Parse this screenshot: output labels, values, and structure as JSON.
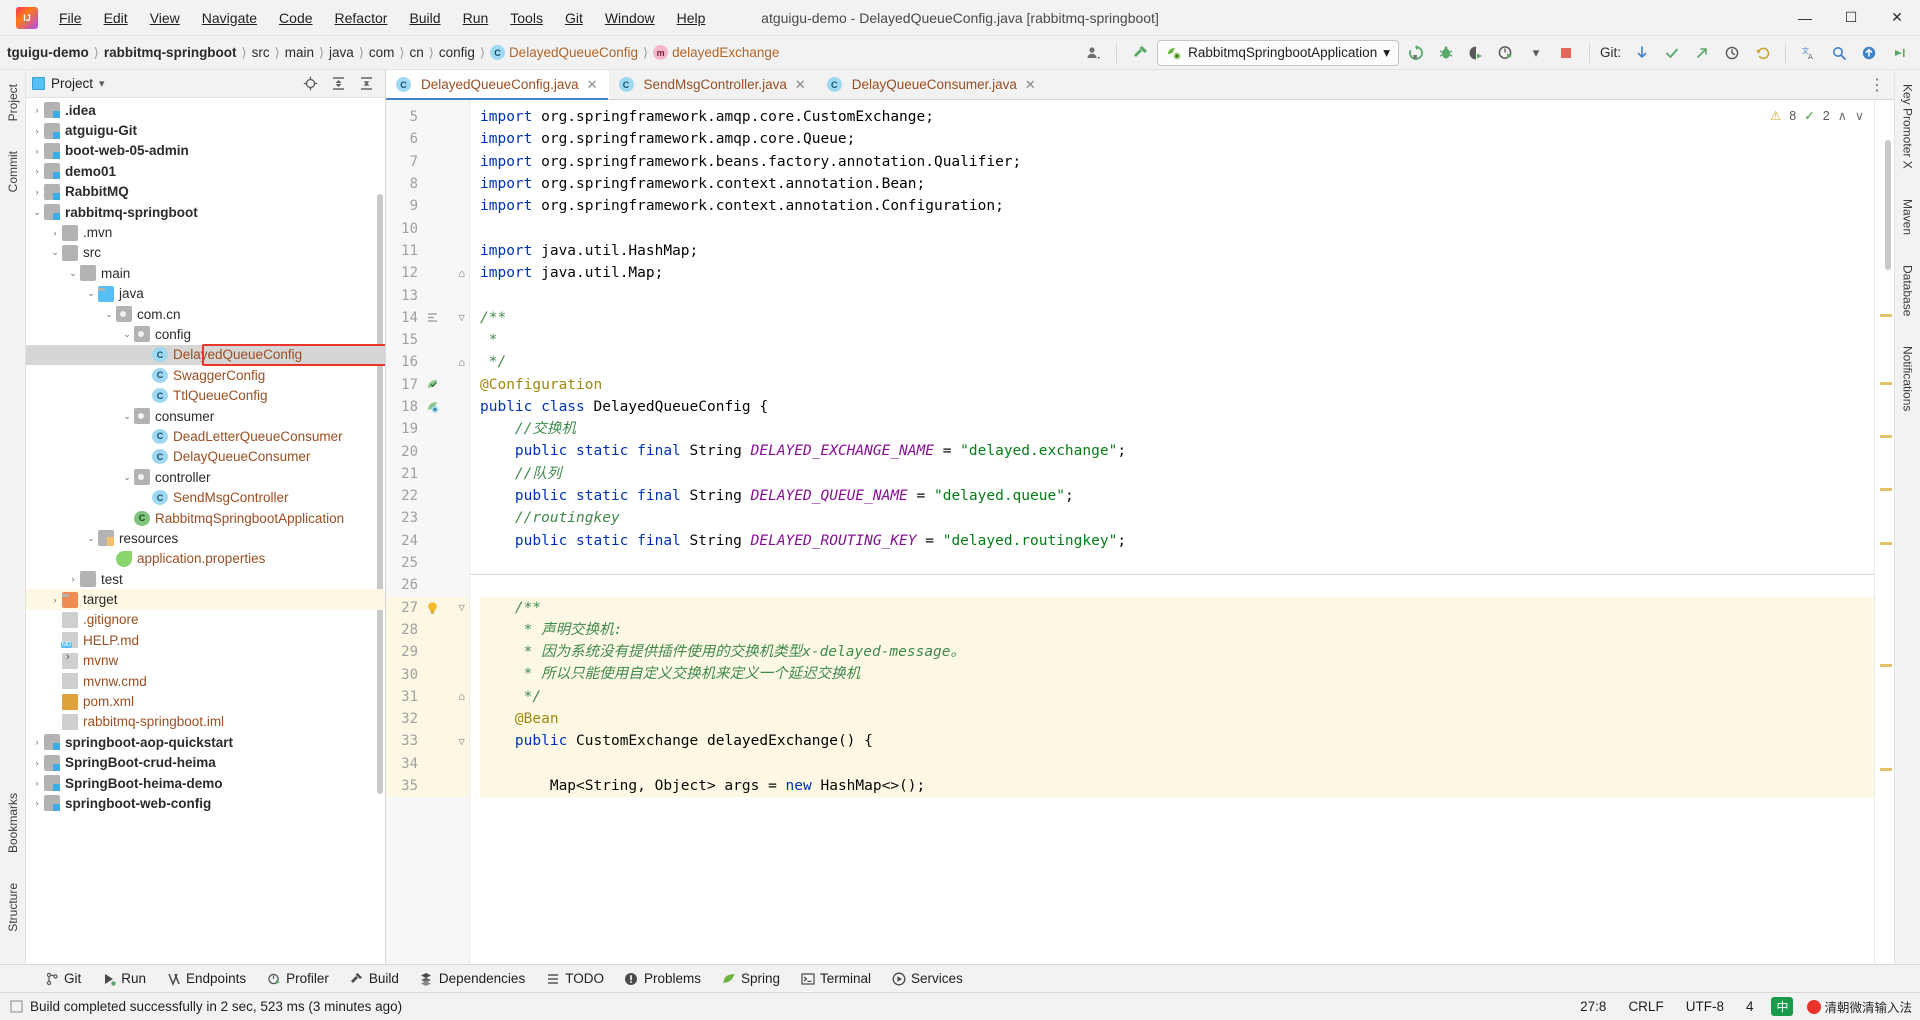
{
  "window": {
    "title": "atguigu-demo - DelayedQueueConfig.java [rabbitmq-springboot]",
    "minimize": "—",
    "maximize": "☐",
    "close": "✕",
    "logo_text": "IJ"
  },
  "menubar": [
    {
      "label": "File"
    },
    {
      "label": "Edit"
    },
    {
      "label": "View"
    },
    {
      "label": "Navigate"
    },
    {
      "label": "Code"
    },
    {
      "label": "Refactor"
    },
    {
      "label": "Build"
    },
    {
      "label": "Run"
    },
    {
      "label": "Tools"
    },
    {
      "label": "Git"
    },
    {
      "label": "Window"
    },
    {
      "label": "Help"
    }
  ],
  "breadcrumbs": [
    {
      "label": "tguigu-demo",
      "style": "bold"
    },
    {
      "label": "rabbitmq-springboot",
      "style": "bold"
    },
    {
      "label": "src",
      "style": "plain"
    },
    {
      "label": "main",
      "style": "plain"
    },
    {
      "label": "java",
      "style": "plain"
    },
    {
      "label": "com",
      "style": "plain"
    },
    {
      "label": "cn",
      "style": "plain"
    },
    {
      "label": "config",
      "style": "plain"
    },
    {
      "label": "DelayedQueueConfig",
      "style": "class",
      "badge": "C"
    },
    {
      "label": "delayedExchange",
      "style": "method",
      "badge": "m"
    }
  ],
  "toolbar": {
    "run_config": "RabbitmqSpringbootApplication",
    "run_config_caret": "▾",
    "git_label": "Git:",
    "icons": {
      "profile": "user-icon",
      "build_hammer": "hammer-icon",
      "rerun": "rerun-icon",
      "debug": "debug-icon",
      "coverage": "coverage-icon",
      "profiler": "profiler-icon",
      "stop": "stop-icon",
      "update_project": "update-project-icon",
      "commit": "commit-icon",
      "push": "push-icon",
      "history": "history-icon",
      "rollback": "rollback-icon",
      "translate": "translate-icon",
      "search": "search-icon",
      "updates": "updates-icon",
      "more": "more-icon"
    }
  },
  "left_strip": [
    {
      "label": "Project"
    },
    {
      "label": "Commit"
    },
    {
      "label": "Bookmarks"
    },
    {
      "label": "Structure"
    }
  ],
  "right_strip": [
    {
      "label": "Key Promoter X"
    },
    {
      "label": "Maven"
    },
    {
      "label": "Database"
    },
    {
      "label": "Notifications"
    }
  ],
  "project_panel": {
    "title": "Project",
    "caret": "▾",
    "actions": [
      "locate-icon",
      "expand-all-icon",
      "collapse-all-icon",
      "settings-icon",
      "hide-icon"
    ],
    "tree": [
      {
        "indent": 1,
        "arrow": "›",
        "icon": "folder-mod",
        "label": ".idea",
        "style": "bold",
        "state": "none"
      },
      {
        "indent": 1,
        "arrow": "›",
        "icon": "folder-mod",
        "label": "atguigu-Git",
        "style": "bold",
        "state": "none"
      },
      {
        "indent": 1,
        "arrow": "›",
        "icon": "folder-mod",
        "label": "boot-web-05-admin",
        "style": "bold",
        "state": "none"
      },
      {
        "indent": 1,
        "arrow": "›",
        "icon": "folder-mod",
        "label": "demo01",
        "style": "bold",
        "state": "none"
      },
      {
        "indent": 1,
        "arrow": "›",
        "icon": "folder-mod",
        "label": "RabbitMQ",
        "style": "bold",
        "state": "none"
      },
      {
        "indent": 1,
        "arrow": "⌄",
        "icon": "folder-mod",
        "label": "rabbitmq-springboot",
        "style": "bold",
        "state": "none"
      },
      {
        "indent": 2,
        "arrow": "›",
        "icon": "folder",
        "label": ".mvn",
        "style": "plain",
        "state": "none"
      },
      {
        "indent": 2,
        "arrow": "⌄",
        "icon": "folder",
        "label": "src",
        "style": "plain",
        "state": "none"
      },
      {
        "indent": 3,
        "arrow": "⌄",
        "icon": "folder",
        "label": "main",
        "style": "plain",
        "state": "none"
      },
      {
        "indent": 4,
        "arrow": "⌄",
        "icon": "folder-src",
        "label": "java",
        "style": "plain",
        "state": "none"
      },
      {
        "indent": 5,
        "arrow": "⌄",
        "icon": "folder-pkg",
        "label": "com.cn",
        "style": "plain",
        "state": "none"
      },
      {
        "indent": 6,
        "arrow": "⌄",
        "icon": "folder-pkg",
        "label": "config",
        "style": "plain",
        "state": "none"
      },
      {
        "indent": 7,
        "arrow": "",
        "icon": "class",
        "label": "DelayedQueueConfig",
        "style": "brown",
        "state": "selected"
      },
      {
        "indent": 7,
        "arrow": "",
        "icon": "class",
        "label": "SwaggerConfig",
        "style": "brown",
        "state": "none"
      },
      {
        "indent": 7,
        "arrow": "",
        "icon": "class",
        "label": "TtlQueueConfig",
        "style": "brown",
        "state": "none"
      },
      {
        "indent": 6,
        "arrow": "⌄",
        "icon": "folder-pkg",
        "label": "consumer",
        "style": "plain",
        "state": "none"
      },
      {
        "indent": 7,
        "arrow": "",
        "icon": "class",
        "label": "DeadLetterQueueConsumer",
        "style": "brown",
        "state": "none"
      },
      {
        "indent": 7,
        "arrow": "",
        "icon": "class",
        "label": "DelayQueueConsumer",
        "style": "brown",
        "state": "none"
      },
      {
        "indent": 6,
        "arrow": "⌄",
        "icon": "folder-pkg",
        "label": "controller",
        "style": "plain",
        "state": "none"
      },
      {
        "indent": 7,
        "arrow": "",
        "icon": "class",
        "label": "SendMsgController",
        "style": "brown",
        "state": "none"
      },
      {
        "indent": 6,
        "arrow": "",
        "icon": "class-run",
        "label": "RabbitmqSpringbootApplication",
        "style": "brown",
        "state": "none"
      },
      {
        "indent": 4,
        "arrow": "⌄",
        "icon": "folder-res",
        "label": "resources",
        "style": "plain",
        "state": "none"
      },
      {
        "indent": 5,
        "arrow": "",
        "icon": "properties",
        "label": "application.properties",
        "style": "brown",
        "state": "none"
      },
      {
        "indent": 3,
        "arrow": "›",
        "icon": "folder",
        "label": "test",
        "style": "plain",
        "state": "none"
      },
      {
        "indent": 2,
        "arrow": "›",
        "icon": "folder-target",
        "label": "target",
        "style": "plain",
        "state": "highlight"
      },
      {
        "indent": 2,
        "arrow": "",
        "icon": "file-ignore",
        "label": ".gitignore",
        "style": "brown",
        "state": "none"
      },
      {
        "indent": 2,
        "arrow": "",
        "icon": "file-md",
        "label": "HELP.md",
        "style": "brown",
        "state": "none"
      },
      {
        "indent": 2,
        "arrow": "",
        "icon": "file-bat",
        "label": "mvnw",
        "style": "brown",
        "state": "none"
      },
      {
        "indent": 2,
        "arrow": "",
        "icon": "file",
        "label": "mvnw.cmd",
        "style": "brown",
        "state": "none"
      },
      {
        "indent": 2,
        "arrow": "",
        "icon": "file-xml",
        "label": "pom.xml",
        "style": "brown",
        "state": "none"
      },
      {
        "indent": 2,
        "arrow": "",
        "icon": "file-iml",
        "label": "rabbitmq-springboot.iml",
        "style": "brown",
        "state": "none"
      },
      {
        "indent": 1,
        "arrow": "›",
        "icon": "folder-mod",
        "label": "springboot-aop-quickstart",
        "style": "bold",
        "state": "none"
      },
      {
        "indent": 1,
        "arrow": "›",
        "icon": "folder-mod",
        "label": "SpringBoot-crud-heima",
        "style": "bold",
        "state": "none"
      },
      {
        "indent": 1,
        "arrow": "›",
        "icon": "folder-mod",
        "label": "SpringBoot-heima-demo",
        "style": "bold",
        "state": "none"
      },
      {
        "indent": 1,
        "arrow": "›",
        "icon": "folder-mod",
        "label": "springboot-web-config",
        "style": "bold",
        "state": "none"
      }
    ]
  },
  "editor": {
    "tabs": [
      {
        "label": "DelayedQueueConfig.java",
        "badge": "C",
        "active": true,
        "close": "✕"
      },
      {
        "label": "SendMsgController.java",
        "badge": "C",
        "active": false,
        "close": "✕"
      },
      {
        "label": "DelayQueueConsumer.java",
        "badge": "C",
        "active": false,
        "close": "✕"
      }
    ],
    "inspection": {
      "warnings": "8",
      "checks": "2",
      "up": "∧",
      "down": "∨"
    },
    "first_line_number": 5,
    "lines": [
      {
        "n": 5,
        "html": "<span class=\"k\">import</span> org.springframework.amqp.core.<span class=\"ty\">CustomExchange</span>;"
      },
      {
        "n": 6,
        "html": "<span class=\"k\">import</span> org.springframework.amqp.core.<span class=\"ty\">Queue</span>;"
      },
      {
        "n": 7,
        "html": "<span class=\"k\">import</span> org.springframework.beans.factory.annotation.<span class=\"ty\">Qualifier</span>;"
      },
      {
        "n": 8,
        "html": "<span class=\"k\">import</span> org.springframework.context.annotation.<span class=\"ty\">Bean</span>;"
      },
      {
        "n": 9,
        "html": "<span class=\"k\">import</span> org.springframework.context.annotation.<span class=\"ty\">Configuration</span>;"
      },
      {
        "n": 10,
        "html": ""
      },
      {
        "n": 11,
        "html": "<span class=\"k\">import</span> java.util.<span class=\"ty\">HashMap</span>;"
      },
      {
        "n": 12,
        "html": "<span class=\"k\">import</span> java.util.<span class=\"ty\">Map</span>;"
      },
      {
        "n": 13,
        "html": ""
      },
      {
        "n": 14,
        "html": "<span class=\"cg\">/**</span>"
      },
      {
        "n": 15,
        "html": "<span class=\"cg\"> *</span>"
      },
      {
        "n": 16,
        "html": "<span class=\"cg\"> */</span>"
      },
      {
        "n": 17,
        "html": "<span class=\"an\">@Configuration</span>"
      },
      {
        "n": 18,
        "html": "<span class=\"k\">public class</span> DelayedQueueConfig {"
      },
      {
        "n": 19,
        "html": "    <span class=\"cg\">//交换机</span>"
      },
      {
        "n": 20,
        "html": "    <span class=\"k\">public static final</span> String <span class=\"cst\">DELAYED_EXCHANGE_NAME</span> = <span class=\"s\">\"delayed.exchange\"</span>;"
      },
      {
        "n": 21,
        "html": "    <span class=\"cg\">//队列</span>"
      },
      {
        "n": 22,
        "html": "    <span class=\"k\">public static final</span> String <span class=\"cst\">DELAYED_QUEUE_NAME</span> = <span class=\"s\">\"delayed.queue\"</span>;"
      },
      {
        "n": 23,
        "html": "    <span class=\"cg\">//routingkey</span>"
      },
      {
        "n": 24,
        "html": "    <span class=\"k\">public static final</span> String <span class=\"cst\">DELAYED_ROUTING_KEY</span> = <span class=\"s\">\"delayed.routingkey\"</span>;"
      },
      {
        "n": 25,
        "html": ""
      },
      {
        "n": 26,
        "html": ""
      },
      {
        "n": 27,
        "html": "    <span class=\"cg\">/**</span>",
        "hl": true
      },
      {
        "n": 28,
        "html": "     <span class=\"cg\">* 声明交换机:</span>",
        "hl": true
      },
      {
        "n": 29,
        "html": "     <span class=\"cg\">* 因为系统没有提供插件使用的交换机类型x-delayed-message。</span>",
        "hl": true
      },
      {
        "n": 30,
        "html": "     <span class=\"cg\">* 所以只能使用自定义交换机来定义一个延迟交换机</span>",
        "hl": true
      },
      {
        "n": 31,
        "html": "     <span class=\"cg\">*/</span>",
        "hl": true
      },
      {
        "n": 32,
        "html": "    <span class=\"an\">@Bean</span>",
        "hl": true
      },
      {
        "n": 33,
        "html": "    <span class=\"k\">public</span> CustomExchange <span class=\"fn\">delayedExchange</span>() {",
        "hl": true
      },
      {
        "n": 34,
        "html": "",
        "hl": true
      },
      {
        "n": 35,
        "html": "        Map&lt;String, Object&gt; args = <span class=\"k\">new</span> HashMap&lt;&gt;();",
        "hl": true
      }
    ]
  },
  "bottom_tools": [
    {
      "label": "Git",
      "icon": "git-branch-icon"
    },
    {
      "label": "Run",
      "icon": "run-icon"
    },
    {
      "label": "Endpoints",
      "icon": "endpoints-icon"
    },
    {
      "label": "Profiler",
      "icon": "profiler-icon"
    },
    {
      "label": "Build",
      "icon": "build-hammer-icon"
    },
    {
      "label": "Dependencies",
      "icon": "dependencies-icon"
    },
    {
      "label": "TODO",
      "icon": "todo-icon"
    },
    {
      "label": "Problems",
      "icon": "problems-icon"
    },
    {
      "label": "Spring",
      "icon": "spring-leaf-icon"
    },
    {
      "label": "Terminal",
      "icon": "terminal-icon"
    },
    {
      "label": "Services",
      "icon": "services-icon"
    }
  ],
  "statusbar": {
    "message": "Build completed successfully in 2 sec, 523 ms (3 minutes ago)",
    "caret_position": "27:8",
    "line_separator": "CRLF",
    "encoding": "UTF-8",
    "indent": "4",
    "ime_badge": "中",
    "ime_text": "清朝微清输入法"
  }
}
